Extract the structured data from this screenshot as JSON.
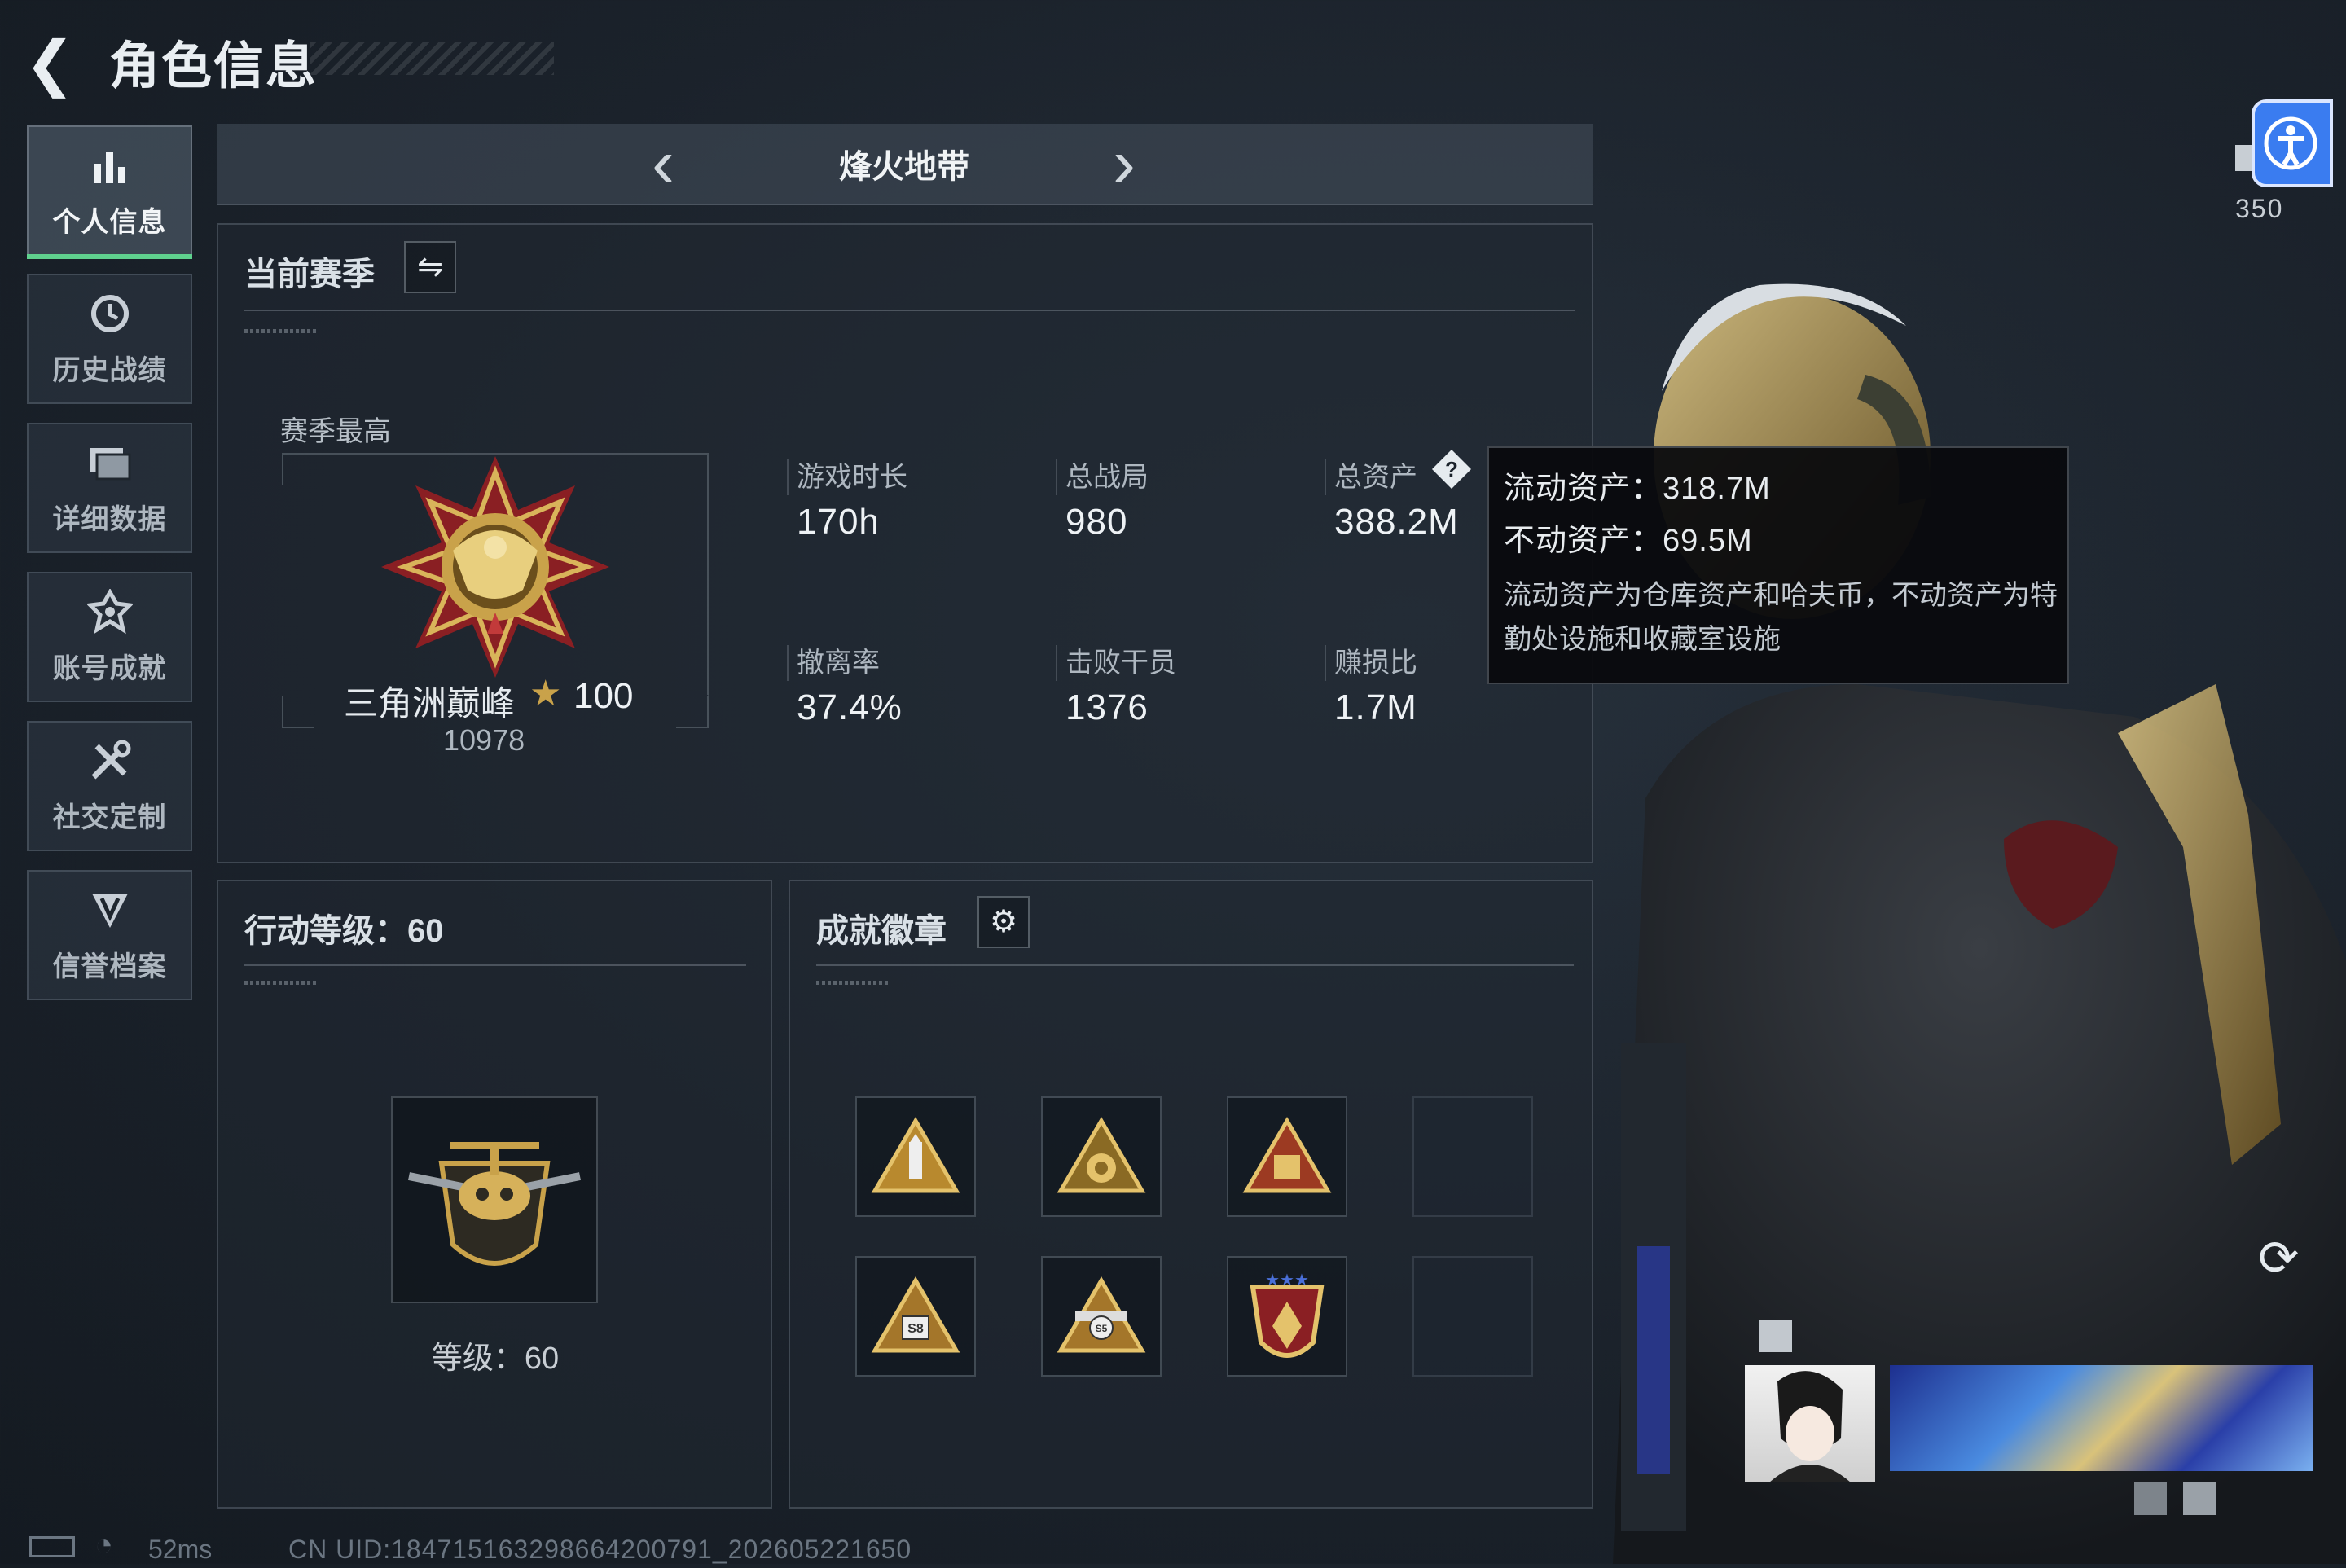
{
  "header": {
    "title": "角色信息"
  },
  "sidebar": {
    "items": [
      {
        "label": "个人信息",
        "icon": "bar-chart-icon"
      },
      {
        "label": "历史战绩",
        "icon": "history-clock-icon"
      },
      {
        "label": "详细数据",
        "icon": "folder-icon"
      },
      {
        "label": "账号成就",
        "icon": "achievement-star-icon"
      },
      {
        "label": "社交定制",
        "icon": "tools-icon"
      },
      {
        "label": "信誉档案",
        "icon": "shield-icon"
      }
    ]
  },
  "mode": {
    "name": "烽火地带"
  },
  "season": {
    "title": "当前赛季",
    "peak_label": "赛季最高",
    "rank_name": "三角洲巅峰",
    "rank_stars": "100",
    "rank_score": "10978"
  },
  "stats": [
    {
      "label": "游戏时长",
      "value": "170h"
    },
    {
      "label": "总战局",
      "value": "980"
    },
    {
      "label": "总资产",
      "value": "388.2M"
    },
    {
      "label": "撤离率",
      "value": "37.4%"
    },
    {
      "label": "击败干员",
      "value": "1376"
    },
    {
      "label": "赚损比",
      "value": "1.7M"
    }
  ],
  "tooltip": {
    "line1": "流动资产：318.7M",
    "line2": "不动资产：69.5M",
    "note": "流动资产为仓库资产和哈夫币，不动资产为特勤处设施和收藏室设施"
  },
  "level": {
    "title": "行动等级：60",
    "label": "等级：60"
  },
  "badges": {
    "title": "成就徽章"
  },
  "right": {
    "count": "350"
  },
  "status": {
    "ping": "52ms",
    "uid": "CN UID:184715163298664200791_202605221650"
  },
  "colors": {
    "accent_green": "#5fd18e",
    "accessibility_blue": "#3a7cf0",
    "gold": "#c9a24a"
  }
}
